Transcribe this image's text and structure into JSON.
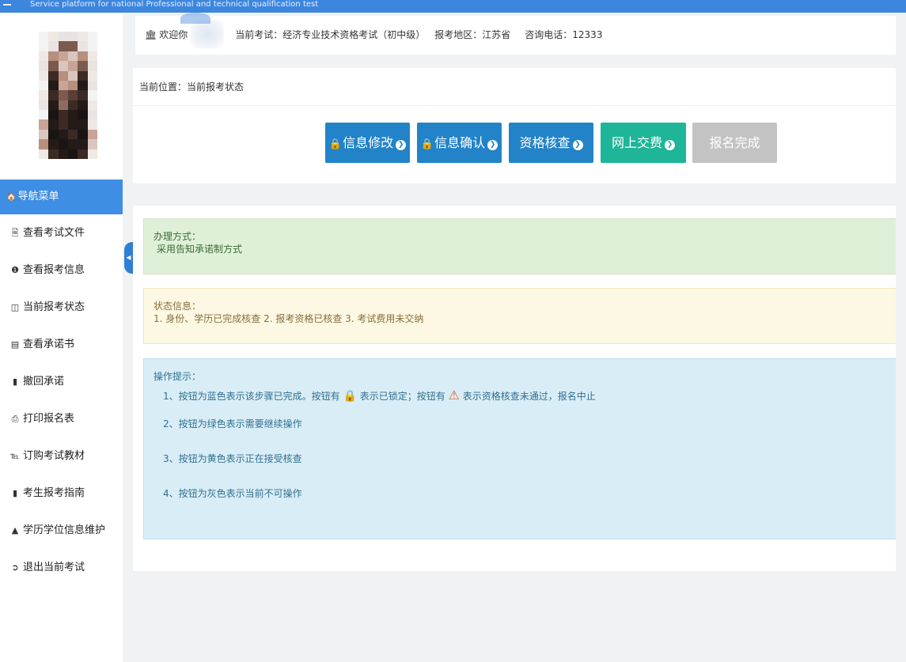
{
  "topbar": {
    "text": "Service platform for national Professional and technical qualification test"
  },
  "header": {
    "welcome": "欢迎你",
    "exam": "当前考试：经济专业技术资格考试（初中级）",
    "region": "报考地区：江苏省",
    "phone": "咨询电话：12333"
  },
  "location": "当前位置：当前报考状态",
  "steps": [
    {
      "label": "信息修改",
      "locked": true,
      "arrow": true,
      "color": "#2283c8"
    },
    {
      "label": "信息确认",
      "locked": true,
      "arrow": true,
      "color": "#2283c8"
    },
    {
      "label": "资格核查",
      "locked": false,
      "arrow": true,
      "color": "#2283c8"
    },
    {
      "label": "网上交费",
      "locked": false,
      "arrow": true,
      "color": "#1eb598"
    },
    {
      "label": "报名完成",
      "locked": false,
      "arrow": false,
      "color": "#c3c3c3"
    }
  ],
  "method": {
    "title": "办理方式：",
    "text": "采用告知承诺制方式"
  },
  "status": {
    "title": "状态信息：",
    "text": "1. 身份、学历已完成核查 2. 报考资格已核查 3. 考试费用未交纳"
  },
  "tips": {
    "title": "操作提示：",
    "line1_a": "1、按钮为蓝色表示该步骤已完成。按钮有",
    "line1_b": "表示已锁定；按钮有",
    "line1_c": "表示资格核查未通过，报名中止",
    "line2": "2、按钮为绿色表示需要继续操作",
    "line3": "3、按钮为黄色表示正在接受核查",
    "line4": "4、按钮为灰色表示当前不可操作"
  },
  "nav": {
    "header": "导航菜单",
    "header_icon": "home-icon",
    "items": [
      {
        "label": "查看考试文件",
        "icon": "file-icon"
      },
      {
        "label": "查看报考信息",
        "icon": "info-icon"
      },
      {
        "label": "当前报考状态",
        "icon": "monitor-icon"
      },
      {
        "label": "查看承诺书",
        "icon": "list-icon"
      },
      {
        "label": "撤回承诺",
        "icon": "book-icon"
      },
      {
        "label": "打印报名表",
        "icon": "print-icon"
      },
      {
        "label": "订购考试教材",
        "icon": "cart-icon"
      },
      {
        "label": "考生报考指南",
        "icon": "book-icon"
      },
      {
        "label": "学历学位信息维护",
        "icon": "graduation-cap-icon"
      },
      {
        "label": "退出当前考试",
        "icon": "logout-icon"
      }
    ]
  },
  "colors": {
    "accent": "#3d8ee4",
    "step_blue": "#2283c8",
    "step_green": "#1eb598",
    "step_gray": "#c3c3c3"
  }
}
